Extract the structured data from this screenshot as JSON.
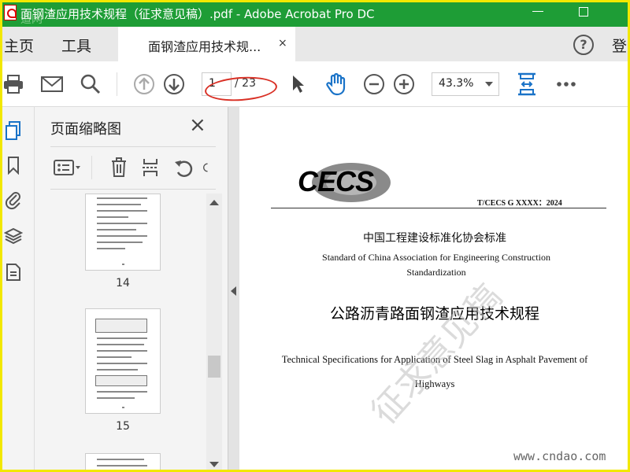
{
  "window": {
    "title": "面钢渣应用技术规程（征求意见稿）.pdf - Adobe Acrobat Pro DC",
    "watermark_overlay": "道网"
  },
  "tabbar": {
    "home_label": "主页",
    "tools_label": "工具",
    "doc_tab_label": "面钢渣应用技术规...",
    "close_symbol": "×",
    "help_symbol": "?",
    "login_label": "登"
  },
  "toolbar": {
    "current_page": "1",
    "total_pages": "/ 23",
    "zoom": "43.3%"
  },
  "thumbnail_panel": {
    "title": "页面缩略图",
    "close_symbol": "×",
    "thumbnails": [
      {
        "label": "14"
      },
      {
        "label": "15"
      }
    ]
  },
  "document": {
    "logo_text": "CECS",
    "standard_number": "T/CECS G XXXX：2024",
    "org_cn": "中国工程建设标准化协会标准",
    "org_en": "Standard of China Association for Engineering Construction Standardization",
    "title_cn": "公路沥青路面钢渣应用技术规程",
    "title_en": "Technical Specifications for Application of Steel Slag in Asphalt Pavement of Highways",
    "watermark_text": "征求意见稿",
    "watermark_url": "www.cndao.com"
  },
  "colors": {
    "titlebar": "#1e9d36",
    "accent_blue": "#1a73c8",
    "annotation_red": "#d93025",
    "frame_yellow": "#f2e800"
  }
}
